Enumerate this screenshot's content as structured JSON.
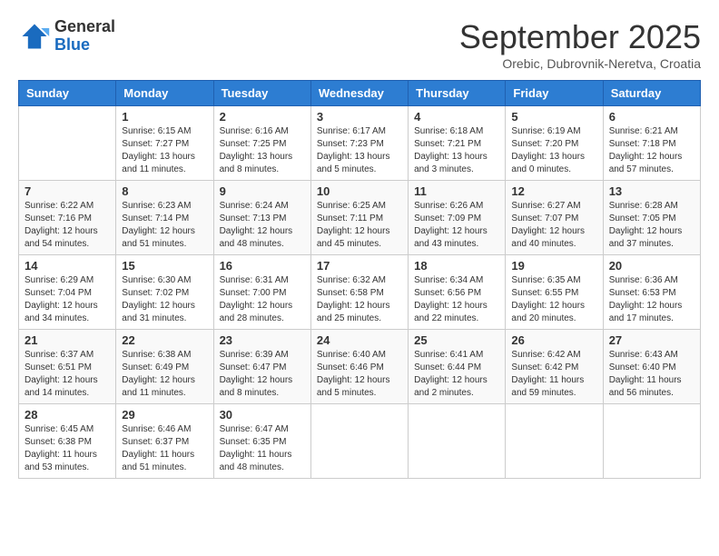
{
  "header": {
    "logo_general": "General",
    "logo_blue": "Blue",
    "month_title": "September 2025",
    "subtitle": "Orebic, Dubrovnik-Neretva, Croatia"
  },
  "weekdays": [
    "Sunday",
    "Monday",
    "Tuesday",
    "Wednesday",
    "Thursday",
    "Friday",
    "Saturday"
  ],
  "weeks": [
    [
      {
        "day": "",
        "info": ""
      },
      {
        "day": "1",
        "info": "Sunrise: 6:15 AM\nSunset: 7:27 PM\nDaylight: 13 hours\nand 11 minutes."
      },
      {
        "day": "2",
        "info": "Sunrise: 6:16 AM\nSunset: 7:25 PM\nDaylight: 13 hours\nand 8 minutes."
      },
      {
        "day": "3",
        "info": "Sunrise: 6:17 AM\nSunset: 7:23 PM\nDaylight: 13 hours\nand 5 minutes."
      },
      {
        "day": "4",
        "info": "Sunrise: 6:18 AM\nSunset: 7:21 PM\nDaylight: 13 hours\nand 3 minutes."
      },
      {
        "day": "5",
        "info": "Sunrise: 6:19 AM\nSunset: 7:20 PM\nDaylight: 13 hours\nand 0 minutes."
      },
      {
        "day": "6",
        "info": "Sunrise: 6:21 AM\nSunset: 7:18 PM\nDaylight: 12 hours\nand 57 minutes."
      }
    ],
    [
      {
        "day": "7",
        "info": "Sunrise: 6:22 AM\nSunset: 7:16 PM\nDaylight: 12 hours\nand 54 minutes."
      },
      {
        "day": "8",
        "info": "Sunrise: 6:23 AM\nSunset: 7:14 PM\nDaylight: 12 hours\nand 51 minutes."
      },
      {
        "day": "9",
        "info": "Sunrise: 6:24 AM\nSunset: 7:13 PM\nDaylight: 12 hours\nand 48 minutes."
      },
      {
        "day": "10",
        "info": "Sunrise: 6:25 AM\nSunset: 7:11 PM\nDaylight: 12 hours\nand 45 minutes."
      },
      {
        "day": "11",
        "info": "Sunrise: 6:26 AM\nSunset: 7:09 PM\nDaylight: 12 hours\nand 43 minutes."
      },
      {
        "day": "12",
        "info": "Sunrise: 6:27 AM\nSunset: 7:07 PM\nDaylight: 12 hours\nand 40 minutes."
      },
      {
        "day": "13",
        "info": "Sunrise: 6:28 AM\nSunset: 7:05 PM\nDaylight: 12 hours\nand 37 minutes."
      }
    ],
    [
      {
        "day": "14",
        "info": "Sunrise: 6:29 AM\nSunset: 7:04 PM\nDaylight: 12 hours\nand 34 minutes."
      },
      {
        "day": "15",
        "info": "Sunrise: 6:30 AM\nSunset: 7:02 PM\nDaylight: 12 hours\nand 31 minutes."
      },
      {
        "day": "16",
        "info": "Sunrise: 6:31 AM\nSunset: 7:00 PM\nDaylight: 12 hours\nand 28 minutes."
      },
      {
        "day": "17",
        "info": "Sunrise: 6:32 AM\nSunset: 6:58 PM\nDaylight: 12 hours\nand 25 minutes."
      },
      {
        "day": "18",
        "info": "Sunrise: 6:34 AM\nSunset: 6:56 PM\nDaylight: 12 hours\nand 22 minutes."
      },
      {
        "day": "19",
        "info": "Sunrise: 6:35 AM\nSunset: 6:55 PM\nDaylight: 12 hours\nand 20 minutes."
      },
      {
        "day": "20",
        "info": "Sunrise: 6:36 AM\nSunset: 6:53 PM\nDaylight: 12 hours\nand 17 minutes."
      }
    ],
    [
      {
        "day": "21",
        "info": "Sunrise: 6:37 AM\nSunset: 6:51 PM\nDaylight: 12 hours\nand 14 minutes."
      },
      {
        "day": "22",
        "info": "Sunrise: 6:38 AM\nSunset: 6:49 PM\nDaylight: 12 hours\nand 11 minutes."
      },
      {
        "day": "23",
        "info": "Sunrise: 6:39 AM\nSunset: 6:47 PM\nDaylight: 12 hours\nand 8 minutes."
      },
      {
        "day": "24",
        "info": "Sunrise: 6:40 AM\nSunset: 6:46 PM\nDaylight: 12 hours\nand 5 minutes."
      },
      {
        "day": "25",
        "info": "Sunrise: 6:41 AM\nSunset: 6:44 PM\nDaylight: 12 hours\nand 2 minutes."
      },
      {
        "day": "26",
        "info": "Sunrise: 6:42 AM\nSunset: 6:42 PM\nDaylight: 11 hours\nand 59 minutes."
      },
      {
        "day": "27",
        "info": "Sunrise: 6:43 AM\nSunset: 6:40 PM\nDaylight: 11 hours\nand 56 minutes."
      }
    ],
    [
      {
        "day": "28",
        "info": "Sunrise: 6:45 AM\nSunset: 6:38 PM\nDaylight: 11 hours\nand 53 minutes."
      },
      {
        "day": "29",
        "info": "Sunrise: 6:46 AM\nSunset: 6:37 PM\nDaylight: 11 hours\nand 51 minutes."
      },
      {
        "day": "30",
        "info": "Sunrise: 6:47 AM\nSunset: 6:35 PM\nDaylight: 11 hours\nand 48 minutes."
      },
      {
        "day": "",
        "info": ""
      },
      {
        "day": "",
        "info": ""
      },
      {
        "day": "",
        "info": ""
      },
      {
        "day": "",
        "info": ""
      }
    ]
  ]
}
